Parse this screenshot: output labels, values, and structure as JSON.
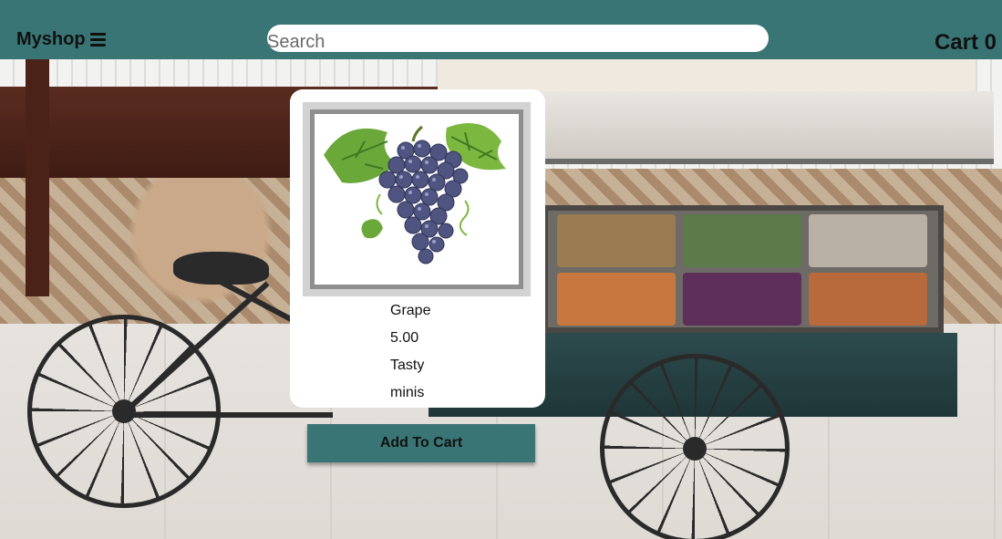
{
  "header": {
    "brand": "Myshop",
    "menu_icon": "hamburger-menu-icon",
    "search_placeholder": "Search",
    "search_value": "",
    "cart_label": "Cart 0"
  },
  "product": {
    "image_icon": "grape-bunch-image",
    "name": "Grape",
    "price": "5.00",
    "description": "Tasty",
    "category": "minis",
    "add_button": "Add To Cart"
  },
  "colors": {
    "accent": "#3a7575",
    "card_bg": "#ffffff",
    "text": "#111111"
  }
}
